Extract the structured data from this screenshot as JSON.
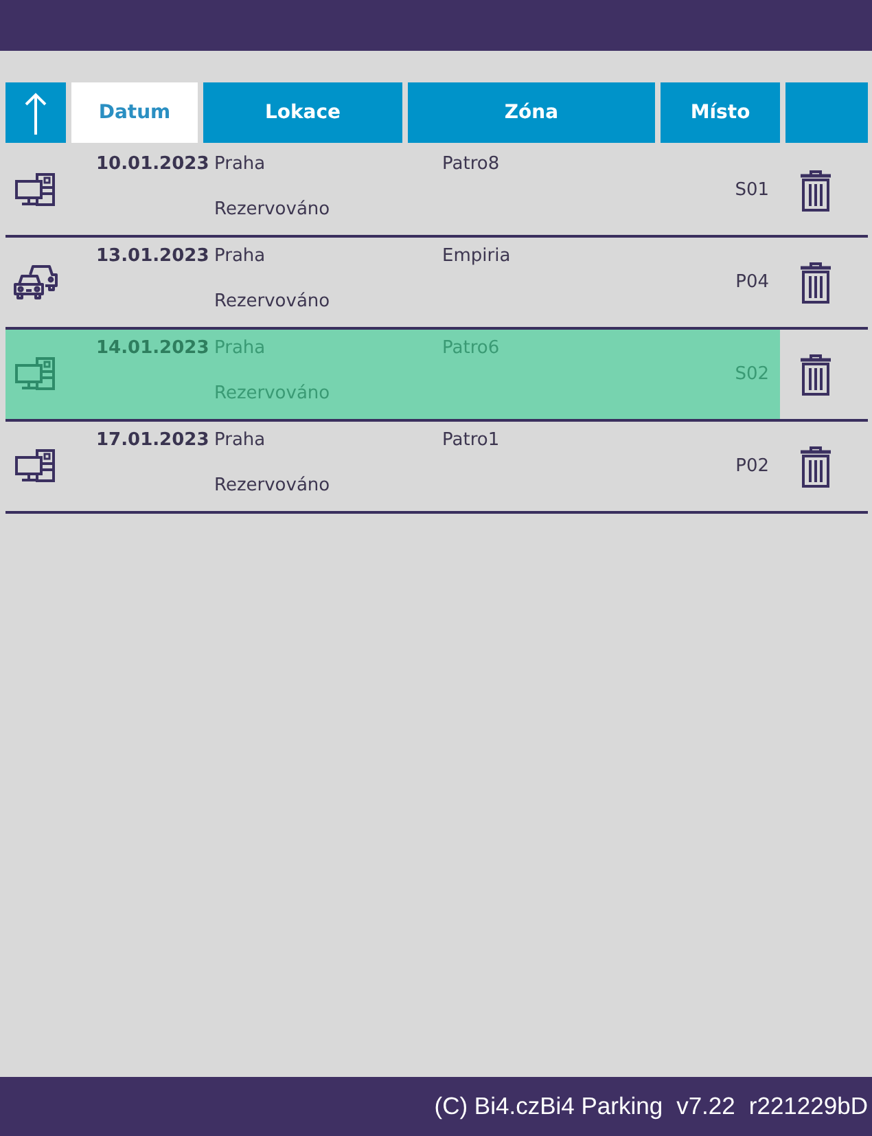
{
  "table": {
    "columns": [
      {
        "label": "Datum",
        "selected": true
      },
      {
        "label": "Lokace",
        "selected": false
      },
      {
        "label": "Zóna",
        "selected": false
      },
      {
        "label": "Místo",
        "selected": false
      }
    ],
    "rows": [
      {
        "kind": "desk",
        "date": "10.01.2023",
        "location": "Praha",
        "status": "Rezervováno",
        "zone": "Patro8",
        "place": "S01",
        "selected": false
      },
      {
        "kind": "car",
        "date": "13.01.2023",
        "location": "Praha",
        "status": "Rezervováno",
        "zone": "Empiria",
        "place": "P04",
        "selected": false
      },
      {
        "kind": "desk",
        "date": "14.01.2023",
        "location": "Praha",
        "status": "Rezervováno",
        "zone": "Patro6",
        "place": "S02",
        "selected": true
      },
      {
        "kind": "desk",
        "date": "17.01.2023",
        "location": "Praha",
        "status": "Rezervováno",
        "zone": "Patro1",
        "place": "P02",
        "selected": false
      }
    ]
  },
  "footer": {
    "copyright": "(C) Bi4.czBi4 Parking",
    "version": "v7.22",
    "revision": "r221229bD"
  }
}
